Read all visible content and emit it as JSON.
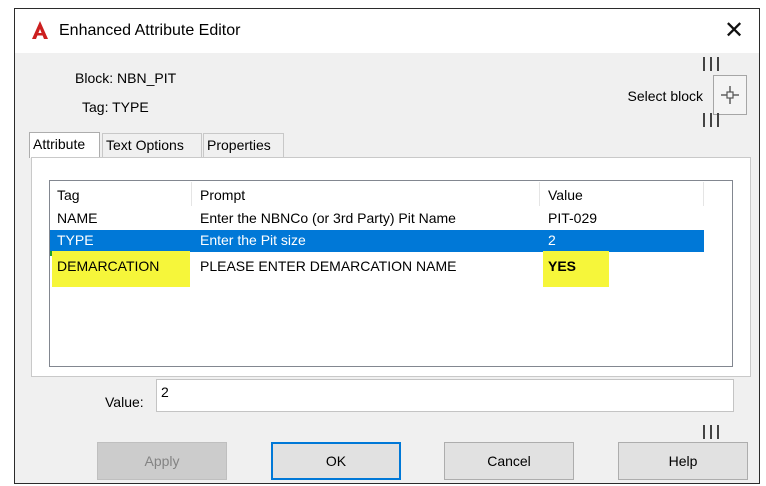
{
  "window": {
    "title": "Enhanced Attribute Editor",
    "close_symbol": "✕"
  },
  "info": {
    "block": "Block: NBN_PIT",
    "tag": "Tag: TYPE"
  },
  "select_block": {
    "label": "Select block",
    "icon": "crosshair-pick-icon"
  },
  "tabs": [
    {
      "label": "Attribute",
      "active": true
    },
    {
      "label": "Text Options",
      "active": false
    },
    {
      "label": "Properties",
      "active": false
    }
  ],
  "table": {
    "columns": [
      "Tag",
      "Prompt",
      "Value"
    ],
    "rows": [
      {
        "tag": "NAME",
        "prompt": "Enter the NBNCo (or 3rd Party) Pit Name",
        "value": "PIT-029",
        "selected": false
      },
      {
        "tag": "TYPE",
        "prompt": "Enter the Pit size",
        "value": "2",
        "selected": true
      },
      {
        "tag": "DEMARCATION",
        "prompt": "PLEASE ENTER DEMARCATION NAME",
        "value": "YES",
        "selected": false
      }
    ]
  },
  "value_field": {
    "label": "Value:",
    "value": "2"
  },
  "buttons": {
    "apply": "Apply",
    "ok": "OK",
    "cancel": "Cancel",
    "help": "Help"
  },
  "colors": {
    "selection": "#0078d7",
    "highlighter": "#f6f63a",
    "app_icon": "#cc1f1f"
  }
}
